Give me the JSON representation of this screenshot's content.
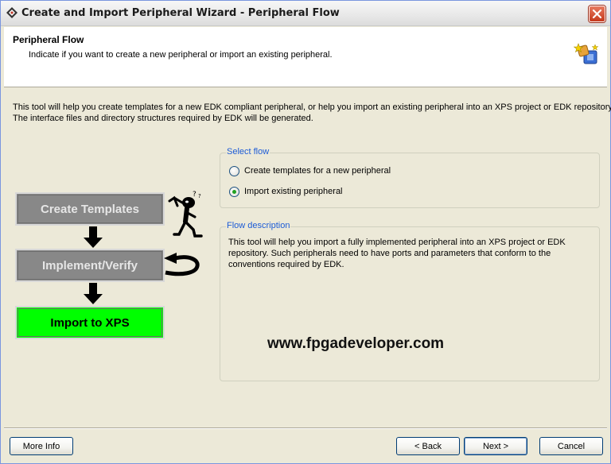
{
  "window": {
    "title": "Create and Import Peripheral Wizard - Peripheral Flow"
  },
  "header": {
    "title": "Peripheral Flow",
    "subtitle": "Indicate if you want to create a new peripheral or import an existing peripheral."
  },
  "intro": {
    "line1": "This tool will help you create templates for a new EDK compliant peripheral, or help you import an existing peripheral into an XPS project or EDK repository.",
    "line2": "The interface files and directory structures required by EDK will be generated."
  },
  "diagram": {
    "steps": [
      {
        "label": "Create Templates"
      },
      {
        "label": "Implement/Verify"
      },
      {
        "label": "Import to XPS"
      }
    ]
  },
  "select_flow": {
    "label": "Select flow",
    "options": [
      {
        "label": "Create templates for a new peripheral",
        "checked": false
      },
      {
        "label": "Import existing peripheral",
        "checked": true
      }
    ]
  },
  "flow_description": {
    "label": "Flow description",
    "text": "This tool will help you import a fully implemented peripheral into an XPS project or EDK repository. Such peripherals need to have ports and parameters that conform to the conventions required by EDK.",
    "watermark": "www.fpgadeveloper.com"
  },
  "buttons": {
    "more_info": "More Info",
    "back": "< Back",
    "next": "Next >",
    "cancel": "Cancel"
  },
  "colors": {
    "title_accent": "#1c5bd6",
    "step_active": "#00ff00",
    "step_inactive": "#888888",
    "close_button": "#c5391c"
  }
}
